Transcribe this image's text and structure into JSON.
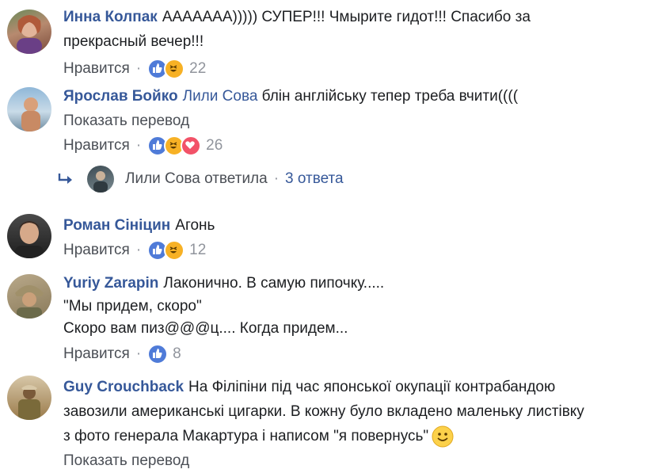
{
  "comments": [
    {
      "author": "Инна Колпак",
      "lines": [
        "ААААААА))))) СУПЕР!!! Чмырите гидот!!! Спасибо за",
        "прекрасный вечер!!!"
      ],
      "like_label": "Нравится",
      "reactions": [
        "like-icon",
        "haha-icon"
      ],
      "count": "22"
    },
    {
      "author": "Ярослав Бойко",
      "mention": "Лили Сова",
      "text": "блін англійську тепер треба вчити((((",
      "translate_label": "Показать перевод",
      "like_label": "Нравится",
      "reactions": [
        "like-icon",
        "haha-icon",
        "love-icon"
      ],
      "count": "26",
      "reply": {
        "text": "Лили Сова ответила",
        "count": "3 ответа"
      }
    },
    {
      "author": "Роман Сініцин",
      "text": "Агонь",
      "like_label": "Нравится",
      "reactions": [
        "like-icon",
        "haha-icon"
      ],
      "count": "12"
    },
    {
      "author": "Yuriy Zarapin",
      "lines": [
        "Лаконично. В самую пипочку.....",
        "\"Мы придем, скоро\"",
        "Скоро вам пиз@@@ц.... Когда придем..."
      ],
      "like_label": "Нравится",
      "reactions": [
        "like-icon"
      ],
      "count": "8"
    },
    {
      "author": "Guy Crouchback",
      "lines": [
        "На Філіпіни під час японської окупації контрабандою",
        "завозили американські цигарки. В кожну було вкладено маленьку листівку",
        "з фото генерала Макартура і написом \"я повернусь\""
      ],
      "translate_label": "Показать перевод"
    }
  ],
  "colors": {
    "link": "#365899",
    "text": "#1c1e21",
    "meta": "#90949c",
    "like": "#4f7bd8",
    "haha": "#f7b125",
    "love": "#f25268"
  },
  "separator": "·"
}
